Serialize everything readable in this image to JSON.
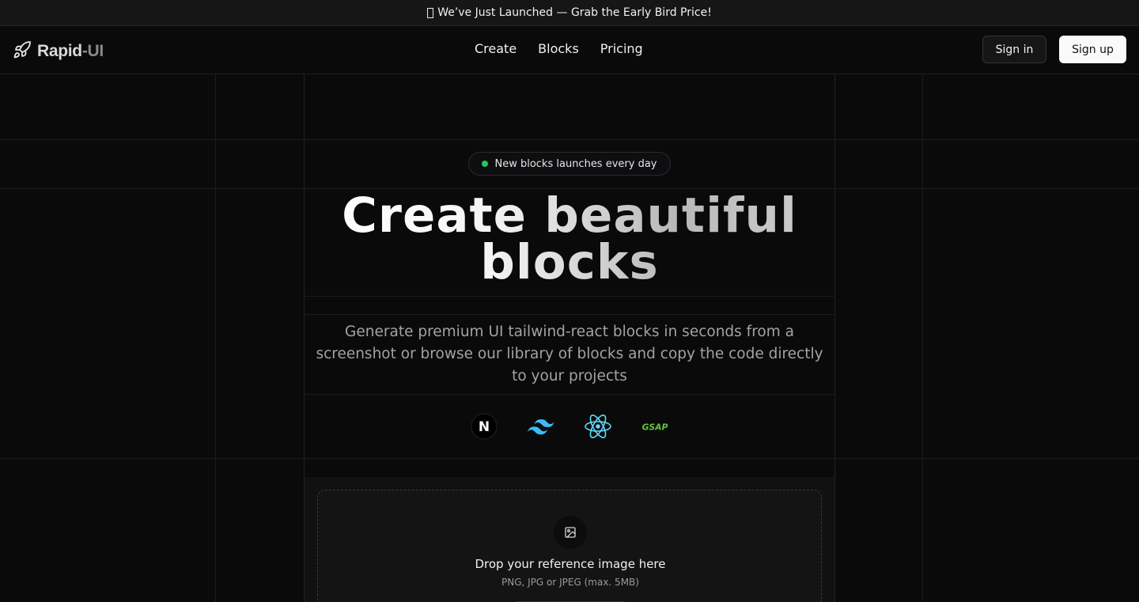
{
  "announcement": {
    "text": "We’ve Just Launched — Grab the Early Bird Price!"
  },
  "nav": {
    "brand_primary": "Rapid",
    "brand_secondary": "-UI",
    "links": [
      "Create",
      "Blocks",
      "Pricing"
    ],
    "sign_in": "Sign in",
    "sign_up": "Sign up"
  },
  "hero": {
    "badge": "New blocks launches every day",
    "title_line1": "Create beautiful",
    "title_line2": "blocks",
    "subtitle": "Generate premium UI tailwind-react blocks in seconds from a screenshot or browse our library of blocks and copy the code directly to your projects",
    "tech": [
      {
        "name": "nextjs-icon",
        "label": "N"
      },
      {
        "name": "tailwind-icon"
      },
      {
        "name": "react-icon"
      },
      {
        "name": "gsap-icon",
        "label": "GSAP"
      }
    ]
  },
  "upload": {
    "title": "Drop your reference image here",
    "hint": "PNG, JPG or JPEG (max. 5MB)"
  },
  "colors": {
    "background": "#0a0a0b",
    "badge_dot": "#22c55e",
    "tailwind": "#38bdf8",
    "react": "#61dafb",
    "gsap": "#66c23a"
  }
}
